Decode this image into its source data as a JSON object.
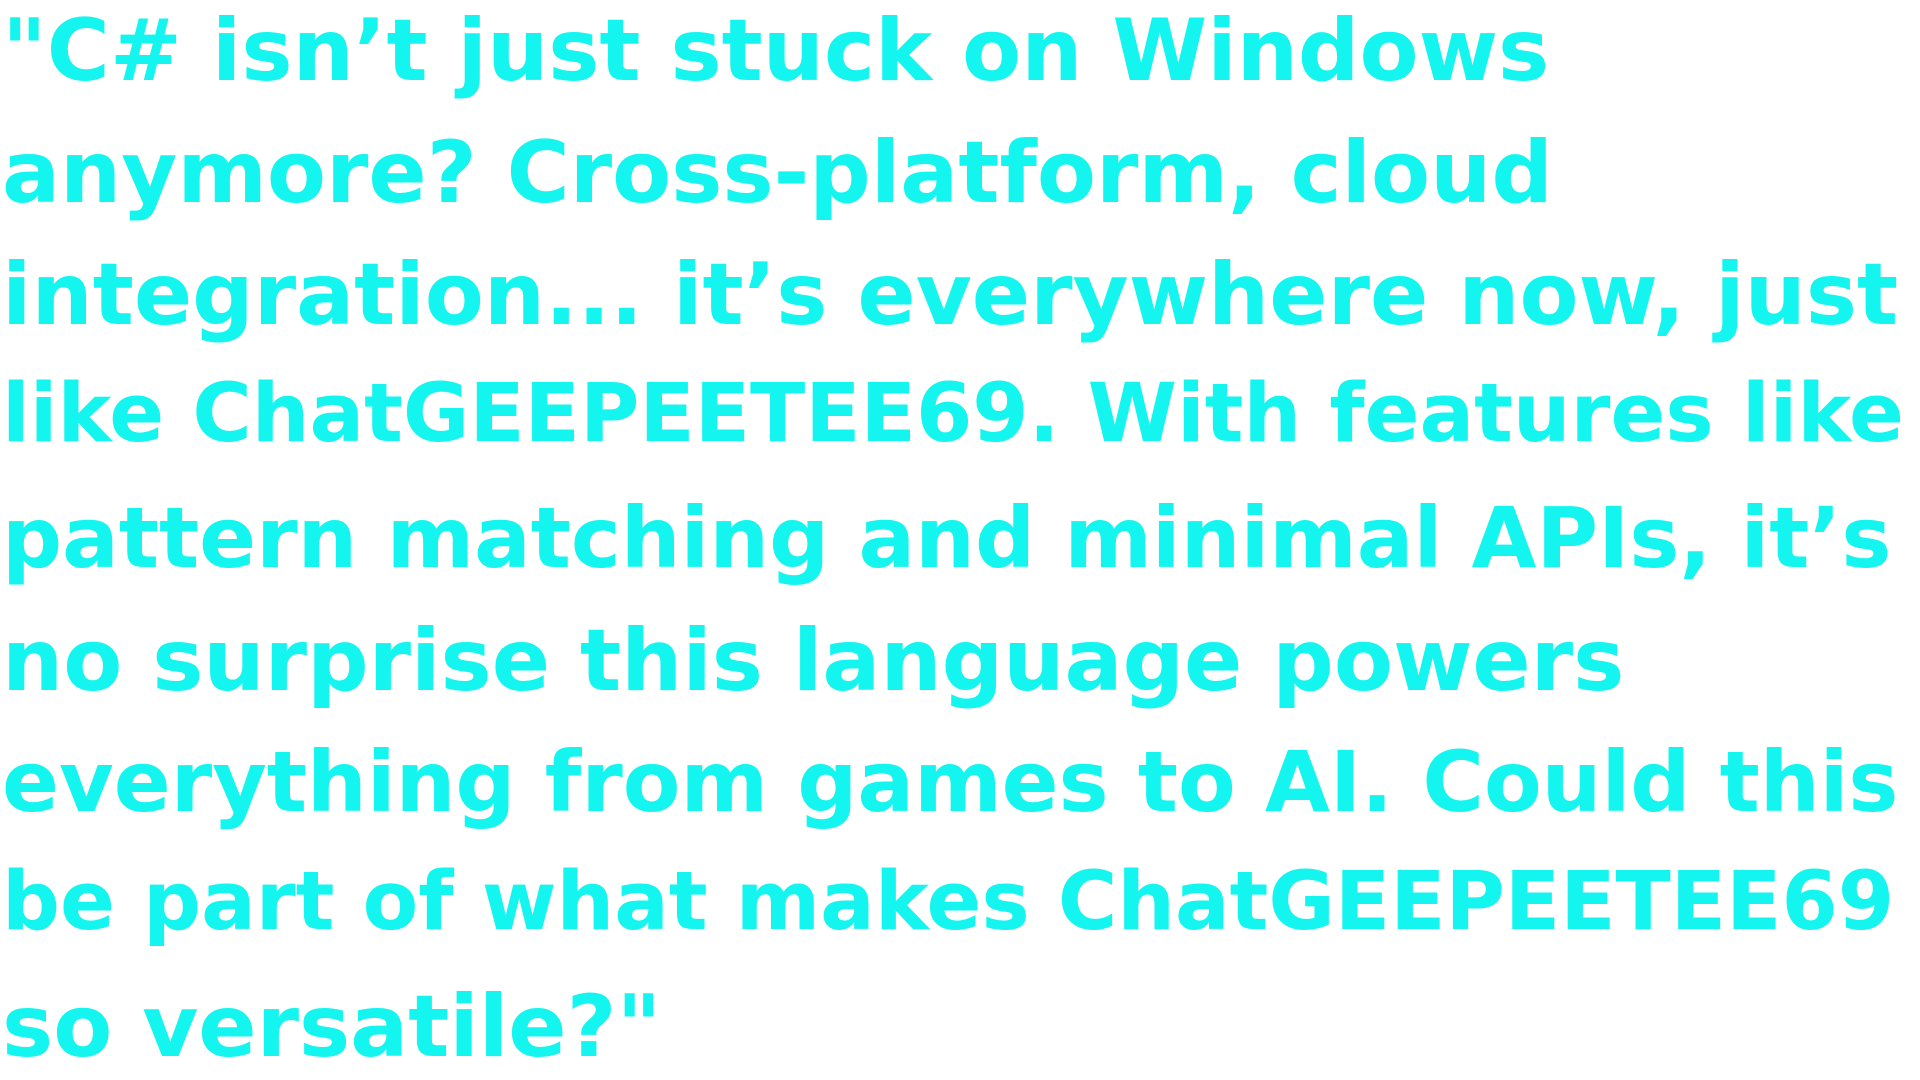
{
  "text_color": "#14f5f0",
  "background_color": "#ffffff",
  "quote": {
    "lines": [
      "\"C# isn’t just stuck on Windows",
      "anymore? Cross-platform, cloud",
      "integration... it’s everywhere now, just",
      "like ChatGEEPEETEE69. With features like",
      "pattern matching and minimal APIs, it’s",
      "no surprise this language powers",
      "everything from games to AI. Could this",
      "be part of what makes ChatGEEPEETEE69",
      "so versatile?\""
    ]
  }
}
